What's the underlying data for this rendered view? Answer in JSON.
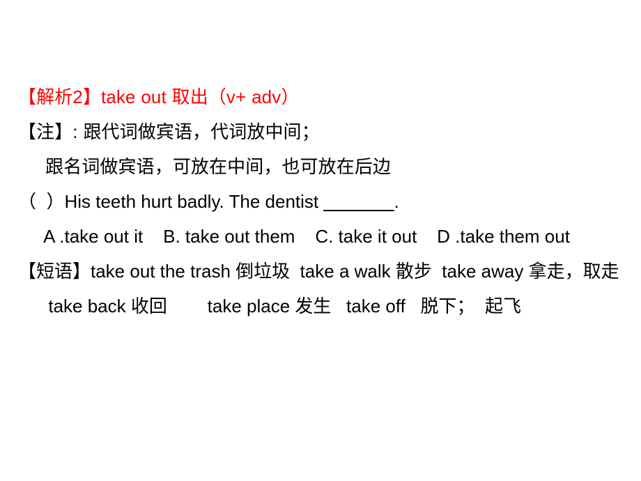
{
  "slide": {
    "background_color": "#ffffff",
    "text_color": "#000000",
    "accent_color": "#ff0000",
    "lines": {
      "heading": "【解析2】take out 取出（v+ adv）",
      "note_1": "【注】: 跟代词做宾语，代词放中间；",
      "note_2": "     跟名词做宾语，可放在中间，也可放在后边",
      "question_prefix": "（  ）His teeth hurt badly. The dentist ",
      "question_blank": "_______",
      "question_suffix": ".",
      "options": "     A .take out it    B. take out them    C. take it out    D .take them out",
      "phrases_1": "【短语】take out the trash 倒垃圾  take a walk 散步  take away 拿走，取走",
      "phrases_2": "      take back 收回        take place 发生   take off   脱下；  起飞"
    },
    "option_items": [
      "A .take out it",
      "B. take out them",
      "C. take it out",
      "D .take them out"
    ],
    "phrase_items": [
      {
        "en": "take out the trash",
        "zh": "倒垃圾"
      },
      {
        "en": "take a walk",
        "zh": "散步"
      },
      {
        "en": "take away",
        "zh": "拿走，取走"
      },
      {
        "en": "take back",
        "zh": "收回"
      },
      {
        "en": "take place",
        "zh": "发生"
      },
      {
        "en": "take off",
        "zh": "脱下；起飞"
      }
    ]
  }
}
